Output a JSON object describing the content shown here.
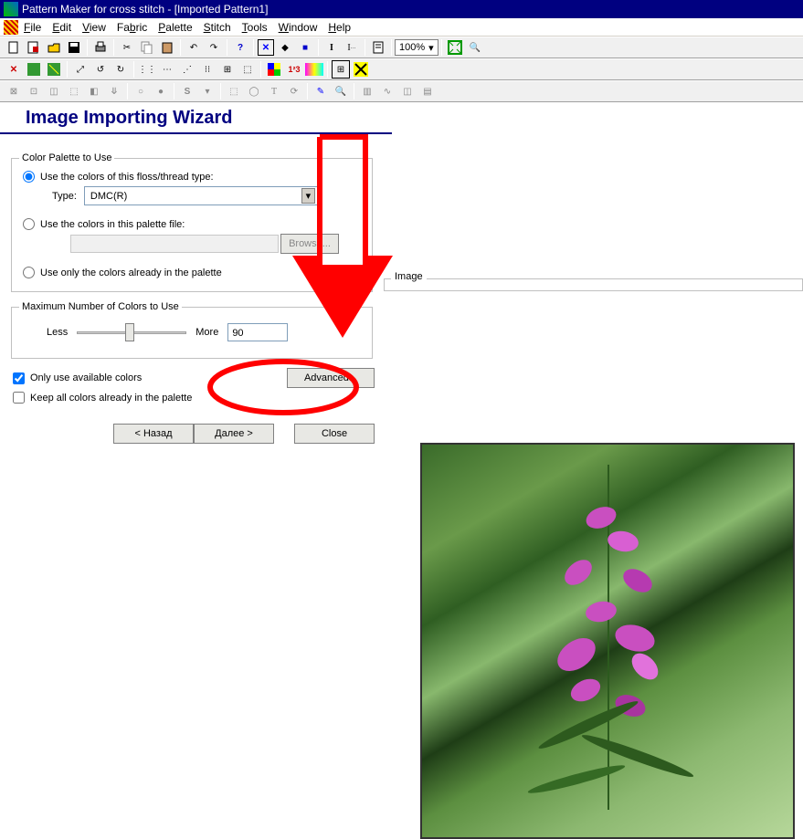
{
  "window": {
    "title": "Pattern Maker for cross stitch - [Imported Pattern1]"
  },
  "menu": [
    "File",
    "Edit",
    "View",
    "Fabric",
    "Palette",
    "Stitch",
    "Tools",
    "Window",
    "Help"
  ],
  "toolbar": {
    "zoom": "100%"
  },
  "wizard": {
    "title": "Image Importing Wizard",
    "palette": {
      "legend": "Color Palette to Use",
      "opt_floss": "Use the colors of this floss/thread type:",
      "type_label": "Type:",
      "type_value": "DMC(R)",
      "opt_palette_file": "Use the colors in this palette file:",
      "browse": "Browse...",
      "opt_already": "Use only the colors already in the palette"
    },
    "max_colors": {
      "legend": "Maximum Number of Colors to Use",
      "less": "Less",
      "more": "More",
      "value": "90"
    },
    "only_available": "Only use available colors",
    "keep_existing": "Keep all colors already in the palette",
    "advanced": "Advanced...",
    "back": "< Назад",
    "next": "Далее >",
    "close": "Close"
  },
  "image_panel": {
    "legend": "Image"
  }
}
